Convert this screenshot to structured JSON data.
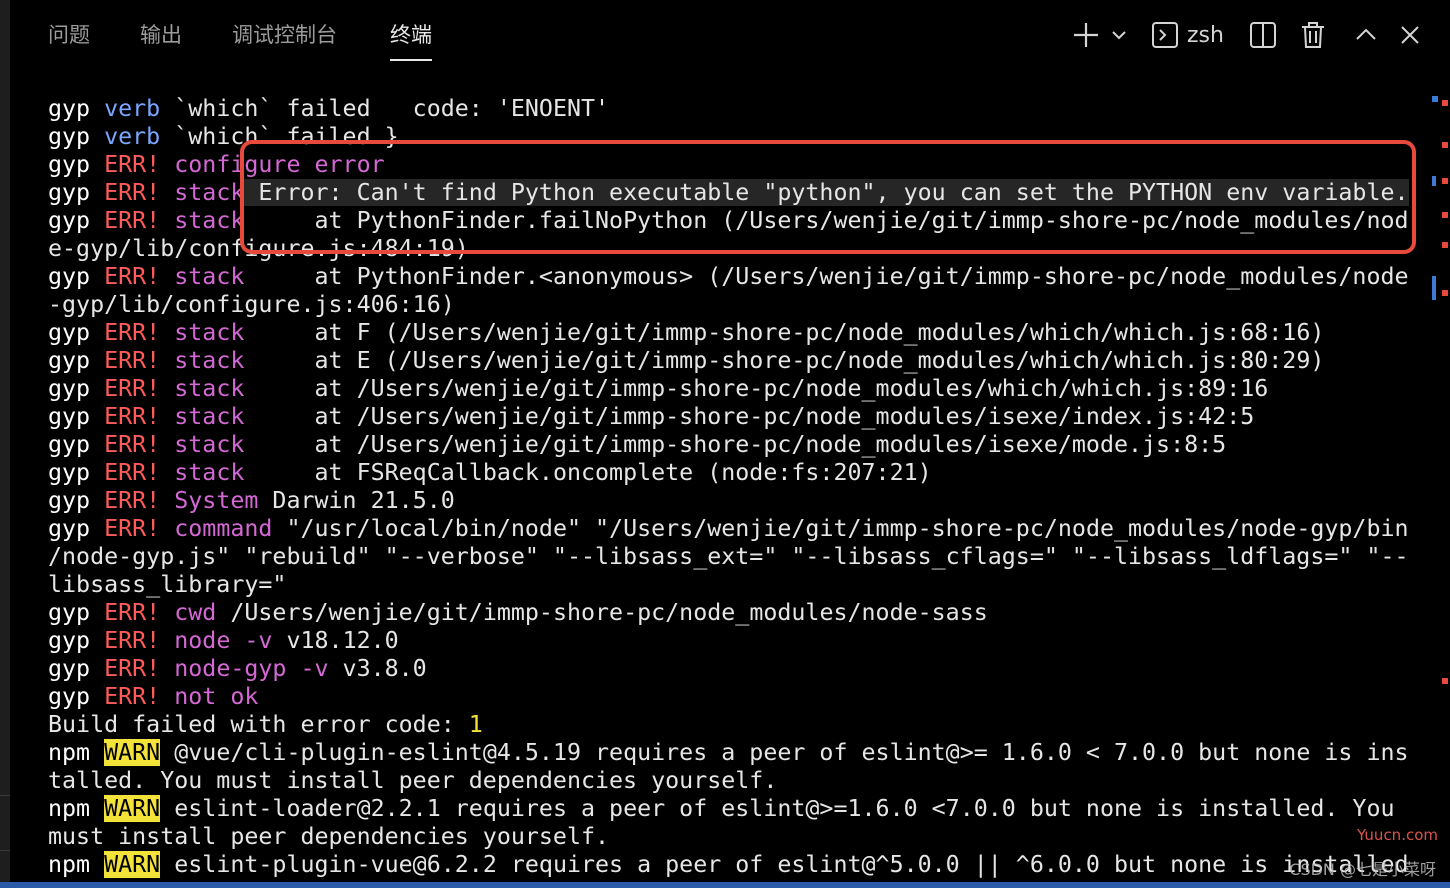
{
  "tabs": [
    {
      "label": "问题"
    },
    {
      "label": "输出"
    },
    {
      "label": "调试控制台"
    },
    {
      "label": "终端"
    }
  ],
  "toolbar": {
    "shell_name": "zsh"
  },
  "terminal": {
    "lines": [
      [
        [
          "gyp",
          "gyp"
        ],
        [
          " ",
          ""
        ],
        [
          "verb",
          "verb"
        ],
        [
          " `which` failed   code: 'ENOENT'",
          "gray"
        ]
      ],
      [
        [
          "gyp",
          "gyp"
        ],
        [
          " ",
          ""
        ],
        [
          "verb",
          "verb"
        ],
        [
          " `which` failed }",
          "gray"
        ]
      ],
      [
        [
          "gyp",
          "gyp"
        ],
        [
          " ",
          ""
        ],
        [
          "ERR!",
          "err"
        ],
        [
          " configure error",
          "mag"
        ]
      ],
      [
        [
          "gyp",
          "gyp"
        ],
        [
          " ",
          ""
        ],
        [
          "ERR!",
          "err"
        ],
        [
          " stack",
          "mag"
        ],
        [
          " Error: Can't find Python executable \"python\", you can set the PYTHON env variable.",
          "hl"
        ]
      ],
      [
        [
          "gyp",
          "gyp"
        ],
        [
          " ",
          ""
        ],
        [
          "ERR!",
          "err"
        ],
        [
          " stack",
          "mag"
        ],
        [
          "     at PythonFinder.failNoPython (/Users/wenjie/git/immp-shore-pc/node_modules/nod",
          "gray"
        ]
      ],
      [
        [
          "e-gyp/lib/configure.js:484:19)",
          "gray"
        ]
      ],
      [
        [
          "gyp",
          "gyp"
        ],
        [
          " ",
          ""
        ],
        [
          "ERR!",
          "err"
        ],
        [
          " stack",
          "mag"
        ],
        [
          "     at PythonFinder.<anonymous> (/Users/wenjie/git/immp-shore-pc/node_modules/node",
          "gray"
        ]
      ],
      [
        [
          "-gyp/lib/configure.js:406:16)",
          "gray"
        ]
      ],
      [
        [
          "gyp",
          "gyp"
        ],
        [
          " ",
          ""
        ],
        [
          "ERR!",
          "err"
        ],
        [
          " stack",
          "mag"
        ],
        [
          "     at F (/Users/wenjie/git/immp-shore-pc/node_modules/which/which.js:68:16)",
          "gray"
        ]
      ],
      [
        [
          "gyp",
          "gyp"
        ],
        [
          " ",
          ""
        ],
        [
          "ERR!",
          "err"
        ],
        [
          " stack",
          "mag"
        ],
        [
          "     at E (/Users/wenjie/git/immp-shore-pc/node_modules/which/which.js:80:29)",
          "gray"
        ]
      ],
      [
        [
          "gyp",
          "gyp"
        ],
        [
          " ",
          ""
        ],
        [
          "ERR!",
          "err"
        ],
        [
          " stack",
          "mag"
        ],
        [
          "     at /Users/wenjie/git/immp-shore-pc/node_modules/which/which.js:89:16",
          "gray"
        ]
      ],
      [
        [
          "gyp",
          "gyp"
        ],
        [
          " ",
          ""
        ],
        [
          "ERR!",
          "err"
        ],
        [
          " stack",
          "mag"
        ],
        [
          "     at /Users/wenjie/git/immp-shore-pc/node_modules/isexe/index.js:42:5",
          "gray"
        ]
      ],
      [
        [
          "gyp",
          "gyp"
        ],
        [
          " ",
          ""
        ],
        [
          "ERR!",
          "err"
        ],
        [
          " stack",
          "mag"
        ],
        [
          "     at /Users/wenjie/git/immp-shore-pc/node_modules/isexe/mode.js:8:5",
          "gray"
        ]
      ],
      [
        [
          "gyp",
          "gyp"
        ],
        [
          " ",
          ""
        ],
        [
          "ERR!",
          "err"
        ],
        [
          " stack",
          "mag"
        ],
        [
          "     at FSReqCallback.oncomplete (node:fs:207:21)",
          "gray"
        ]
      ],
      [
        [
          "gyp",
          "gyp"
        ],
        [
          " ",
          ""
        ],
        [
          "ERR!",
          "err"
        ],
        [
          " System",
          "mag"
        ],
        [
          " Darwin 21.5.0",
          "gray"
        ]
      ],
      [
        [
          "gyp",
          "gyp"
        ],
        [
          " ",
          ""
        ],
        [
          "ERR!",
          "err"
        ],
        [
          " command",
          "mag"
        ],
        [
          " \"/usr/local/bin/node\" \"/Users/wenjie/git/immp-shore-pc/node_modules/node-gyp/bin",
          "gray"
        ]
      ],
      [
        [
          "/node-gyp.js\" \"rebuild\" \"--verbose\" \"--libsass_ext=\" \"--libsass_cflags=\" \"--libsass_ldflags=\" \"--",
          "gray"
        ]
      ],
      [
        [
          "libsass_library=\"",
          "gray"
        ]
      ],
      [
        [
          "gyp",
          "gyp"
        ],
        [
          " ",
          ""
        ],
        [
          "ERR!",
          "err"
        ],
        [
          " cwd",
          "mag"
        ],
        [
          " /Users/wenjie/git/immp-shore-pc/node_modules/node-sass",
          "gray"
        ]
      ],
      [
        [
          "gyp",
          "gyp"
        ],
        [
          " ",
          ""
        ],
        [
          "ERR!",
          "err"
        ],
        [
          " node -v",
          "mag"
        ],
        [
          " v18.12.0",
          "gray"
        ]
      ],
      [
        [
          "gyp",
          "gyp"
        ],
        [
          " ",
          ""
        ],
        [
          "ERR!",
          "err"
        ],
        [
          " node-gyp -v",
          "mag"
        ],
        [
          " v3.8.0",
          "gray"
        ]
      ],
      [
        [
          "gyp",
          "gyp"
        ],
        [
          " ",
          ""
        ],
        [
          "ERR!",
          "err"
        ],
        [
          " not ok",
          "mag"
        ]
      ],
      [
        [
          "Build failed with error code: ",
          "gray"
        ],
        [
          "1",
          "yel"
        ]
      ],
      [
        [
          "npm",
          "gyp"
        ],
        [
          " ",
          ""
        ],
        [
          "WARN",
          "warn"
        ],
        [
          " @vue/cli-plugin-eslint@4.5.19 requires a peer of eslint@>= 1.6.0 < 7.0.0 but none is ins",
          "gray"
        ]
      ],
      [
        [
          "talled. You must install peer dependencies yourself.",
          "gray"
        ]
      ],
      [
        [
          "npm",
          "gyp"
        ],
        [
          " ",
          ""
        ],
        [
          "WARN",
          "warn"
        ],
        [
          " eslint-loader@2.2.1 requires a peer of eslint@>=1.6.0 <7.0.0 but none is installed. You",
          "gray"
        ]
      ],
      [
        [
          "must install peer dependencies yourself.",
          "gray"
        ]
      ],
      [
        [
          "npm",
          "gyp"
        ],
        [
          " ",
          ""
        ],
        [
          "WARN",
          "warn"
        ],
        [
          " eslint-plugin-vue@6.2.2 requires a peer of eslint@^5.0.0 || ^6.0.0 but none is installed",
          "gray"
        ]
      ]
    ]
  },
  "colors": {
    "error_red": "#ff5b5b",
    "keyword_magenta": "#d468d4",
    "verb_blue": "#7aa6ff",
    "warn_yellow": "#f3e23a",
    "annotation_red": "#e74a3a"
  },
  "icons": {
    "add": "plus-icon",
    "dropdown": "chevron-down-icon",
    "shell": "terminal-icon",
    "split": "split-icon",
    "trash": "trash-icon",
    "maximize": "chevron-up-icon",
    "close": "close-icon"
  },
  "watermark": {
    "site": "Yuucn.com",
    "author": "CSDN @七是小菜呀"
  }
}
